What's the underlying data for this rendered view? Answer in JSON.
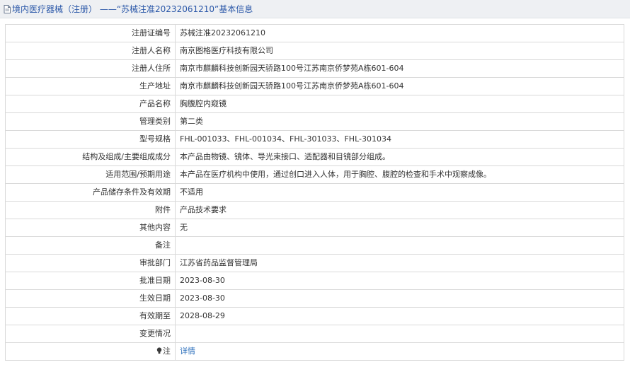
{
  "header": {
    "title": "境内医疗器械（注册） ——“苏械注准20232061210”基本信息"
  },
  "rows": [
    {
      "label": "注册证编号",
      "value": "苏械注准20232061210"
    },
    {
      "label": "注册人名称",
      "value": "南京图格医疗科技有限公司"
    },
    {
      "label": "注册人住所",
      "value": "南京市麒麟科技创新园天骄路100号江苏南京侨梦苑A栋601-604"
    },
    {
      "label": "生产地址",
      "value": "南京市麒麟科技创新园天骄路100号江苏南京侨梦苑A栋601-604"
    },
    {
      "label": "产品名称",
      "value": "胸腹腔内窥镜"
    },
    {
      "label": "管理类别",
      "value": "第二类"
    },
    {
      "label": "型号规格",
      "value": "FHL-001033、FHL-001034、FHL-301033、FHL-301034"
    },
    {
      "label": "结构及组成/主要组成成分",
      "value": "本产品由物镜、镜体、导光束接口、适配器和目镜部分组成。"
    },
    {
      "label": "适用范围/预期用途",
      "value": "本产品在医疗机构中使用，通过创口进入人体，用于胸腔、腹腔的检查和手术中观察成像。"
    },
    {
      "label": "产品储存条件及有效期",
      "value": "不适用"
    },
    {
      "label": "附件",
      "value": "产品技术要求"
    },
    {
      "label": "其他内容",
      "value": "无"
    },
    {
      "label": "备注",
      "value": ""
    },
    {
      "label": "审批部门",
      "value": "江苏省药品监督管理局"
    },
    {
      "label": "批准日期",
      "value": "2023-08-30"
    },
    {
      "label": "生效日期",
      "value": "2023-08-30"
    },
    {
      "label": "有效期至",
      "value": "2028-08-29"
    },
    {
      "label": "变更情况",
      "value": ""
    }
  ],
  "note_row": {
    "label": "注",
    "icon": "lightbulb-icon",
    "value": "详情"
  },
  "colors": {
    "header_bg": "#eef0f3",
    "title": "#2a57a8",
    "link": "#2a6ebb",
    "border": "#d9d9d9"
  }
}
